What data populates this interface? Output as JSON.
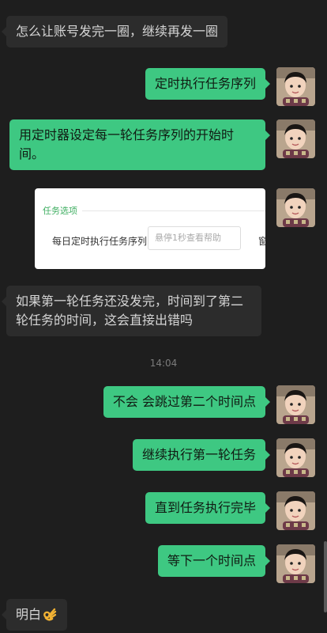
{
  "messages": {
    "m1": "怎么让账号发完一圈，继续再发一圈",
    "m2": "定时执行任务序列",
    "m3": "用定时器设定每一轮任务序列的开始时间。",
    "m4": "如果第一轮任务还没发完，时间到了第二轮任务的时间，这会直接出错吗",
    "m5": "不会 会跳过第二个时间点",
    "m6": "继续执行第一轮任务",
    "m7": "直到任务执行完毕",
    "m8": "等下一个时间点",
    "m9": "明白"
  },
  "timestamp": "14:04",
  "screenshot": {
    "section_title": "任务选项",
    "field_label": "每日定时执行任务序列",
    "field_placeholder": "悬停1秒查看帮助",
    "cut_text": "窗"
  },
  "colors": {
    "background": "#1e1e1e",
    "incoming_bubble": "#2c2c2c",
    "outgoing_bubble": "#3ec882",
    "accent_green": "#3fae61"
  },
  "icons": [
    "avatar-photo",
    "ok-hand-emoji"
  ]
}
